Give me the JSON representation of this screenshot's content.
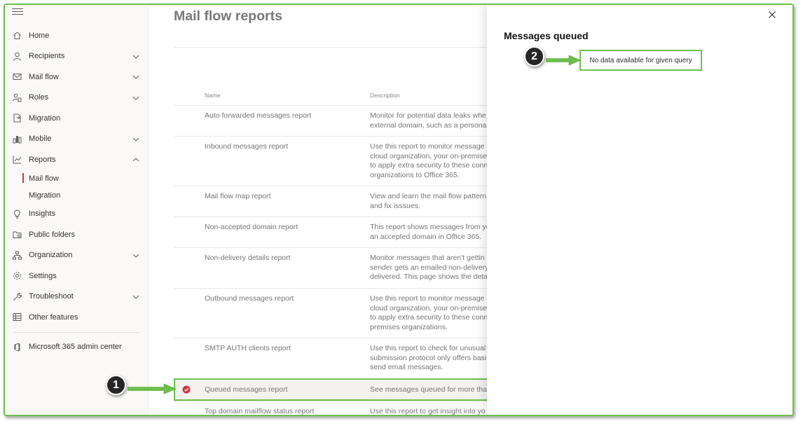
{
  "sidebar": {
    "items": [
      {
        "label": "Home",
        "icon": "home-icon",
        "chevron": false
      },
      {
        "label": "Recipients",
        "icon": "person-icon",
        "chevron": true
      },
      {
        "label": "Mail flow",
        "icon": "mail-icon",
        "chevron": true
      },
      {
        "label": "Roles",
        "icon": "roles-icon",
        "chevron": true
      },
      {
        "label": "Migration",
        "icon": "migration-icon",
        "chevron": false
      },
      {
        "label": "Mobile",
        "icon": "mobile-icon",
        "chevron": true
      },
      {
        "label": "Reports",
        "icon": "chart-icon",
        "chevron": "up"
      },
      {
        "label": "Insights",
        "icon": "lightbulb-icon",
        "chevron": false
      },
      {
        "label": "Public folders",
        "icon": "folder-icon",
        "chevron": false
      },
      {
        "label": "Organization",
        "icon": "org-icon",
        "chevron": true
      },
      {
        "label": "Settings",
        "icon": "gear-icon",
        "chevron": false
      },
      {
        "label": "Troubleshoot",
        "icon": "wrench-icon",
        "chevron": true
      },
      {
        "label": "Other features",
        "icon": "grid-icon",
        "chevron": false
      },
      {
        "label": "Microsoft 365 admin center",
        "icon": "office-icon",
        "chevron": false
      }
    ],
    "reports_sub": [
      "Mail flow",
      "Migration"
    ]
  },
  "main": {
    "title": "Mail flow reports",
    "columns": {
      "name": "Name",
      "description": "Description"
    },
    "rows": [
      {
        "name": "Auto forwarded messages report",
        "desc": [
          "Monitor for potential data leaks whe",
          "external domain, such as a personal"
        ]
      },
      {
        "name": "Inbound messages report",
        "desc": [
          "Use this report to monitor message",
          "cloud organization, your on-premise",
          "to apply extra security to these conn",
          "organizations to Office 365."
        ]
      },
      {
        "name": "Mail flow map report",
        "desc": [
          "View and learn the mail flow pattern",
          "and fix isssues."
        ]
      },
      {
        "name": "Non-accepted domain report",
        "desc": [
          "This report shows messages from yo",
          "an accepted domain in Office 365."
        ]
      },
      {
        "name": "Non-delivery details report",
        "desc": [
          "Monitor messages that aren't gettin",
          "sender gets an emailed non-delivery",
          "delivered. This page shows the detai"
        ]
      },
      {
        "name": "Outbound messages report",
        "desc": [
          "Use this report to monitor message",
          "cloud organization, your on-premise",
          "to apply extra security to these conn",
          "premises organizations."
        ]
      },
      {
        "name": "SMTP AUTH clients report",
        "desc": [
          "Use this report to check for unusual",
          "submission protocol only offers basi",
          "send email messages."
        ]
      },
      {
        "name": "Queued messages report",
        "desc": [
          "See messages queued for more than"
        ],
        "selected": true
      },
      {
        "name": "Top domain mailflow status report",
        "desc": [
          "Use this report to get insight into yo"
        ]
      }
    ]
  },
  "panel": {
    "title": "Messages queued",
    "message": "No data available for given query"
  },
  "callouts": [
    "1",
    "2"
  ],
  "colors": {
    "highlight": "#6cc04a",
    "accent": "#d13438",
    "callout": "#262626"
  }
}
